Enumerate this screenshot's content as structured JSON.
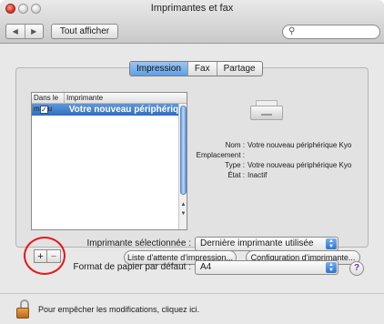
{
  "window": {
    "title": "Imprimantes et fax"
  },
  "toolbar": {
    "back": "◀",
    "forward": "▶",
    "show_all": "Tout afficher",
    "search_placeholder": ""
  },
  "tabs": [
    {
      "label": "Impression",
      "active": true
    },
    {
      "label": "Fax",
      "active": false
    },
    {
      "label": "Partage",
      "active": false
    }
  ],
  "printer_list": {
    "headers": {
      "in_menu": "Dans le menu",
      "printer": "Imprimante"
    },
    "rows": [
      {
        "in_menu": true,
        "name": "Votre nouveau périphérique Kyocera",
        "selected": true
      }
    ]
  },
  "details": {
    "rows": [
      {
        "label": "Nom :",
        "value": "Votre nouveau périphérique Kyo"
      },
      {
        "label": "Emplacement :",
        "value": ""
      },
      {
        "label": "Type :",
        "value": "Votre nouveau périphérique Kyo"
      },
      {
        "label": "État :",
        "value": "Inactif"
      }
    ]
  },
  "list_controls": {
    "add": "+",
    "remove": "−"
  },
  "buttons": {
    "queue": "Liste d'attente d'impression...",
    "config": "Configuration d'imprimante..."
  },
  "settings": {
    "selected_printer_label": "Imprimante sélectionnée :",
    "selected_printer_value": "Dernière imprimante utilisée",
    "paper_label": "Format de papier par défaut :",
    "paper_value": "A4",
    "help": "?"
  },
  "footer": {
    "lock_text": "Pour empêcher les modifications, cliquez ici."
  },
  "colors": {
    "selection": "#2f6fc0",
    "highlight_ring": "#e21b1b",
    "active_tab": "#5da0e6"
  }
}
